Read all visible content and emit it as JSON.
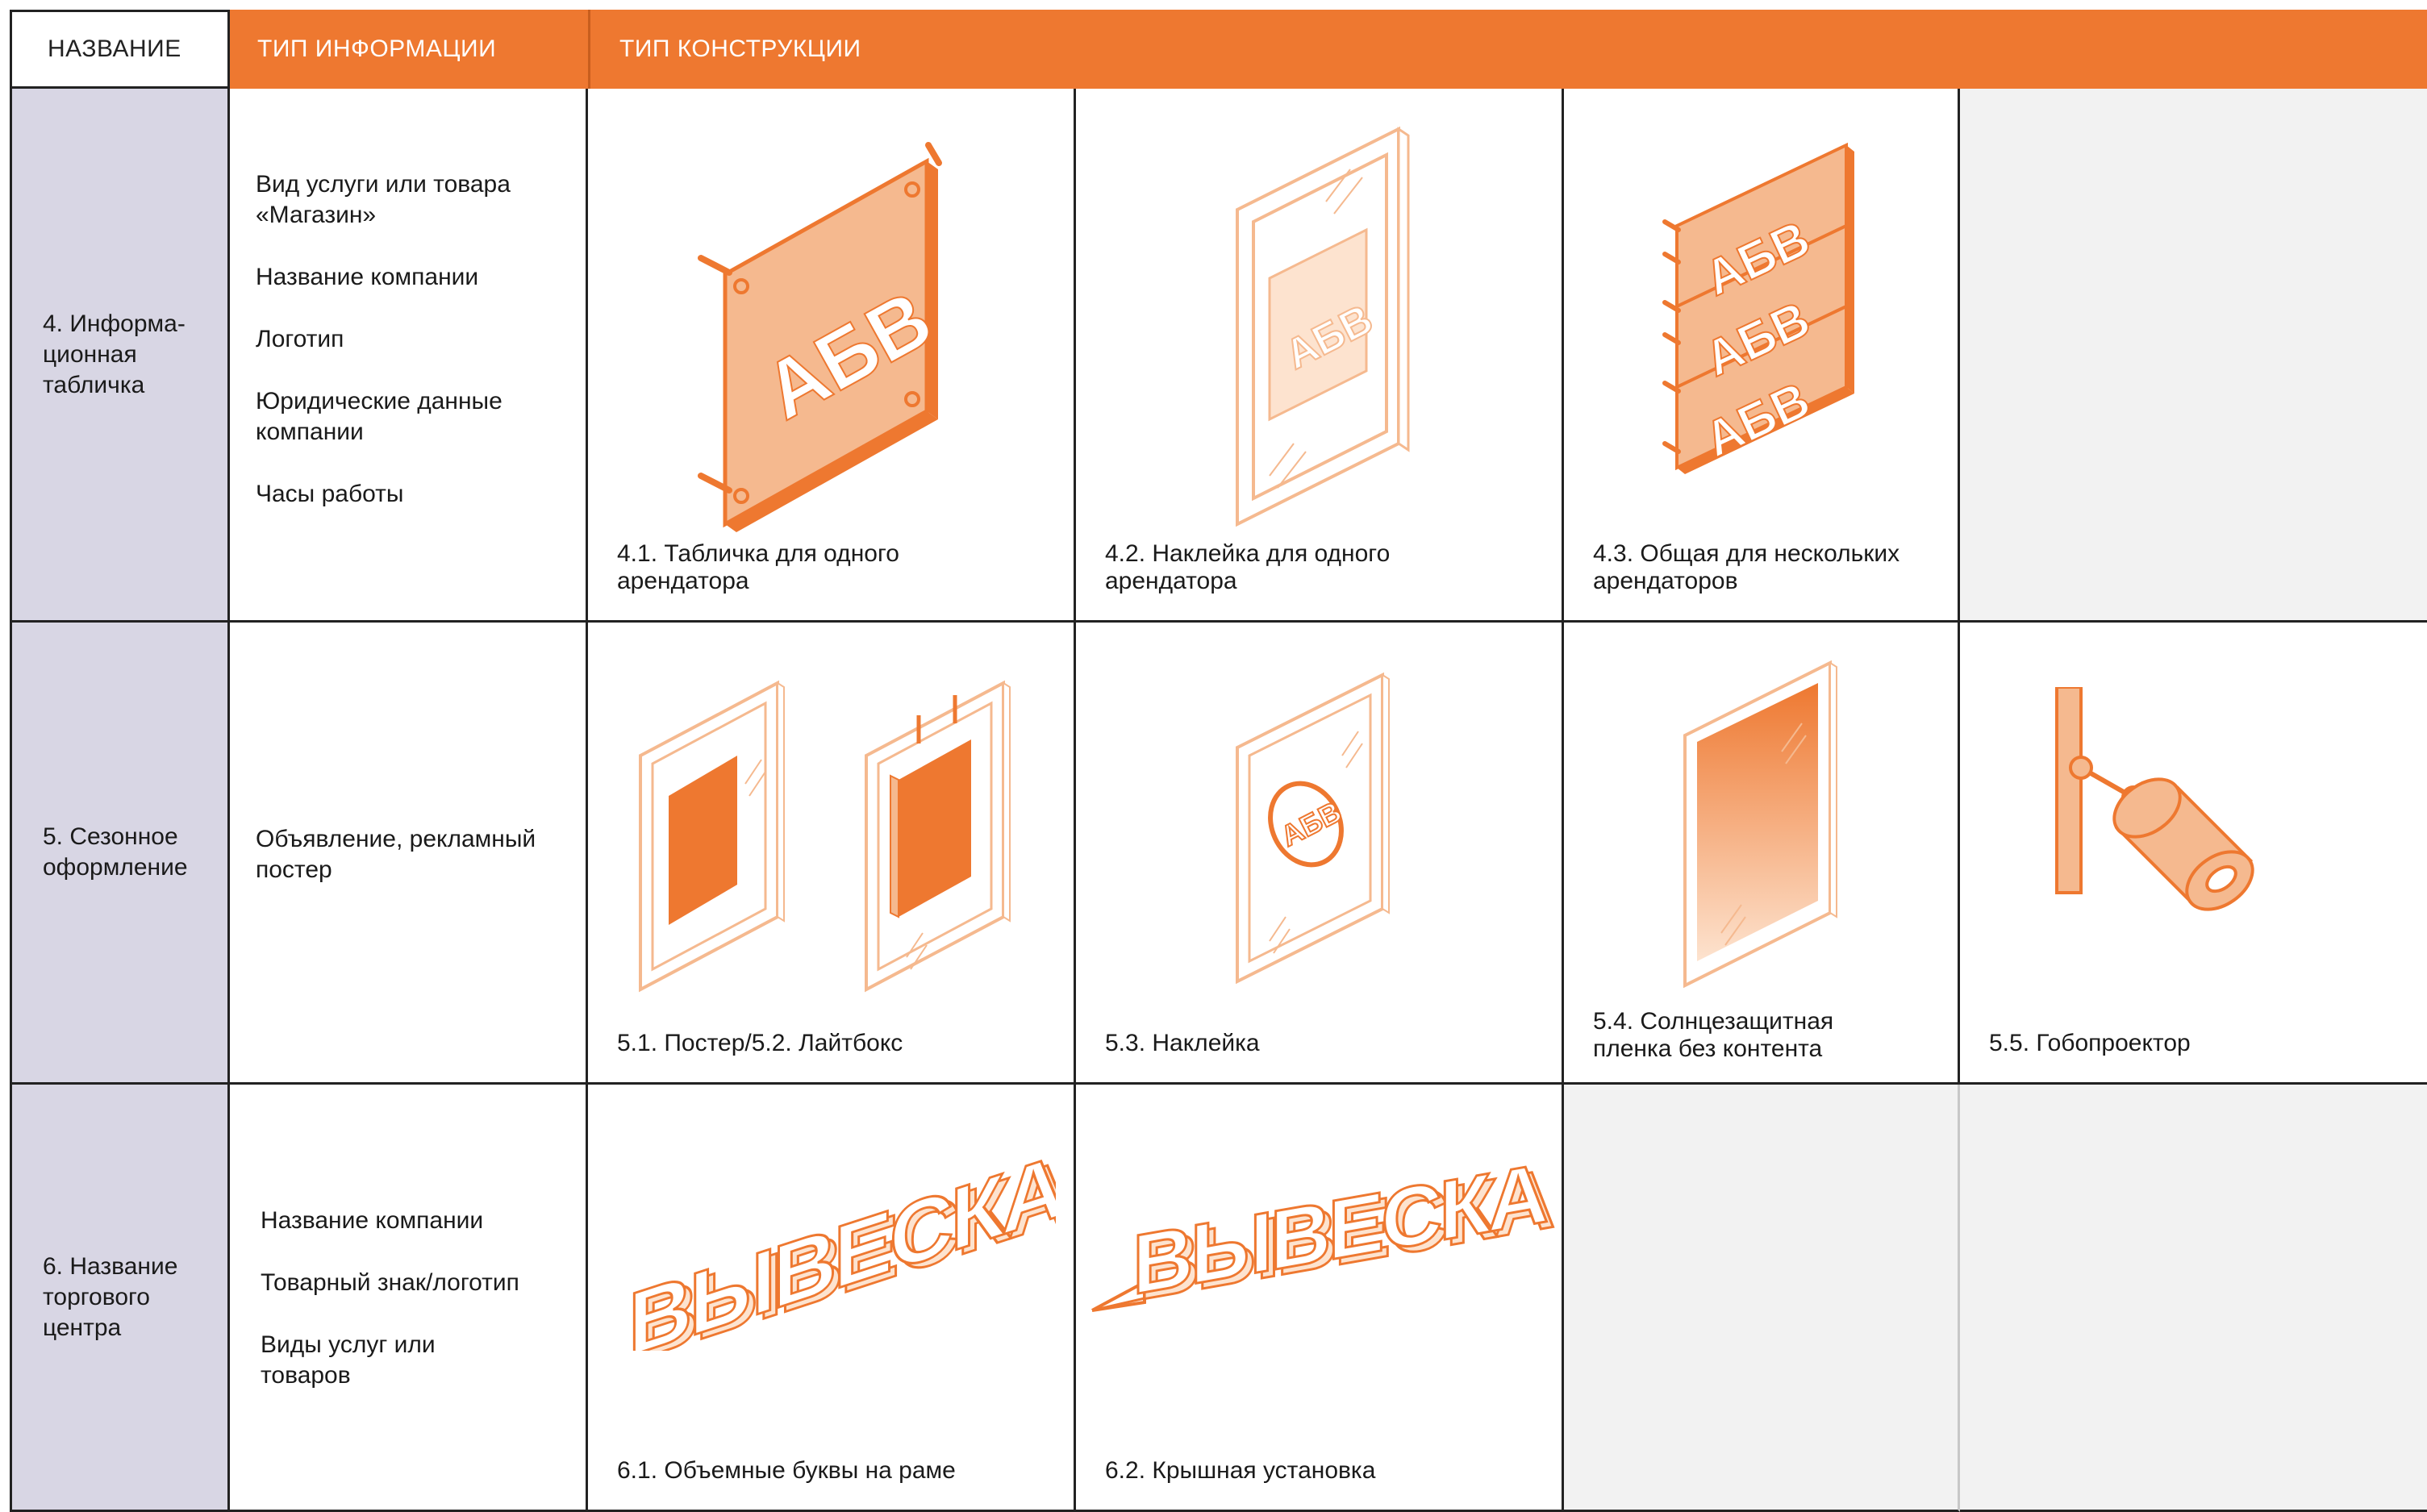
{
  "header": {
    "col_name": "НАЗВАНИЕ",
    "col_info": "ТИП ИНФОРМАЦИИ",
    "col_type": "ТИП КОНСТРУКЦИИ"
  },
  "colors": {
    "accent": "#ee7830",
    "accent_light": "#f5b98f",
    "name_column_bg": "#d8d6e4",
    "empty_cell_bg": "#f2f2f2"
  },
  "rows": [
    {
      "name": "4. Информа-\nционная\nтабличка",
      "info": [
        "Вид услуги или товара\n«Магазин»",
        "Название компании",
        "Логотип",
        "Юридические данные\nкомпании",
        "Часы работы"
      ],
      "cards": [
        {
          "caption": "4.1. Табличка для одного\n      арендатора",
          "icon": "single-plaque-icon",
          "sign_text": "АБВ"
        },
        {
          "caption": "4.2. Наклейка для одного\n      арендатора",
          "icon": "framed-sticker-icon",
          "sign_text": "АБВ"
        },
        {
          "caption": "4.3. Общая для нескольких\nарендаторов",
          "icon": "stacked-plaques-icon",
          "sign_text": "АБВ"
        }
      ]
    },
    {
      "name": "5. Сезонное\nоформление",
      "info": [
        "Объявление, рекламный\nпостер"
      ],
      "cards": [
        {
          "caption": "5.1. Постер/5.2. Лайтбокс",
          "icon": "poster-lightbox-icon"
        },
        {
          "caption": "5.3. Наклейка",
          "icon": "round-sticker-icon",
          "sign_text": "АБВ"
        },
        {
          "caption": "5.4. Солнцезащитная\nпленка без контента",
          "icon": "sun-film-icon"
        },
        {
          "caption": "5.5. Гобопроектор",
          "icon": "gobo-projector-icon"
        }
      ]
    },
    {
      "name": "6. Название\nторгового\nцентра",
      "info": [
        "Название компании",
        "Товарный знак/логотип",
        "Виды услуг или\nтоваров"
      ],
      "cards": [
        {
          "caption": "6.1. Объемные буквы на раме",
          "icon": "frame-letters-icon",
          "sign_text": "ВЫВЕСКА"
        },
        {
          "caption": "6.2. Крышная установка",
          "icon": "rooftop-sign-icon",
          "sign_text": "ВЫВЕСКА"
        }
      ]
    }
  ]
}
